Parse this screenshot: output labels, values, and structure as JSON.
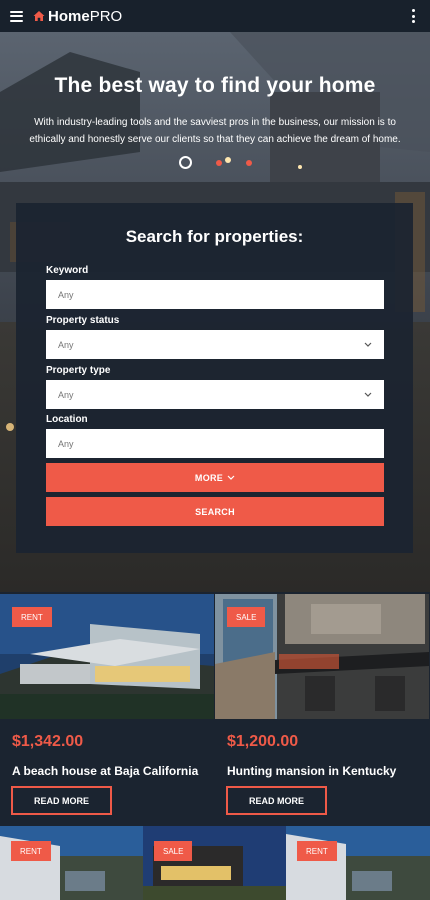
{
  "header": {
    "logo_bold": "Home",
    "logo_light": "PRO"
  },
  "hero": {
    "title": "The best way to find your home",
    "text": "With industry-leading tools and the savviest pros in the business, our mission is to ethically and honestly serve our clients so that they can achieve the dream of home.",
    "slide_count": 3,
    "active_slide": 1
  },
  "search": {
    "title": "Search for properties:",
    "keyword_label": "Keyword",
    "keyword_placeholder": "Any",
    "status_label": "Property status",
    "status_value": "Any",
    "type_label": "Property type",
    "type_value": "Any",
    "location_label": "Location",
    "location_placeholder": "Any",
    "more_label": "MORE",
    "search_label": "SEARCH"
  },
  "listings": [
    {
      "badge": "RENT",
      "price": "$1,342.00",
      "title": "A beach house at Baja California",
      "button": "READ MORE"
    },
    {
      "badge": "SALE",
      "price": "$1,200.00",
      "title": "Hunting mansion in Kentucky",
      "button": "READ MORE"
    }
  ],
  "more_listings": [
    {
      "badge": "RENT"
    },
    {
      "badge": "SALE"
    },
    {
      "badge": "RENT"
    }
  ],
  "colors": {
    "accent": "#ef5a48",
    "background": "#1b2430",
    "header": "#18212c"
  }
}
